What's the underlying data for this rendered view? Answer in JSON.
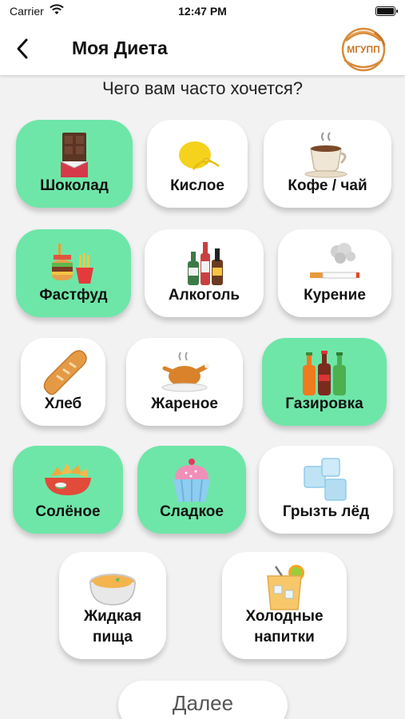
{
  "status_bar": {
    "carrier": "Carrier",
    "time": "12:47 PM"
  },
  "nav": {
    "title": "Моя Диета",
    "logo_text": "МГУПП"
  },
  "question": "Чего вам часто хочется?",
  "options": [
    {
      "label": "Шоколад",
      "selected": true,
      "icon": "chocolate-icon"
    },
    {
      "label": "Кислое",
      "selected": false,
      "icon": "lemon-icon"
    },
    {
      "label": "Кофе / чай",
      "selected": false,
      "icon": "coffee-cup-icon"
    },
    {
      "label": "Фастфуд",
      "selected": true,
      "icon": "fastfood-icon"
    },
    {
      "label": "Алкоголь",
      "selected": false,
      "icon": "bottles-icon"
    },
    {
      "label": "Курение",
      "selected": false,
      "icon": "cigarette-icon"
    },
    {
      "label": "Хлеб",
      "selected": false,
      "icon": "bread-icon"
    },
    {
      "label": "Жареное",
      "selected": false,
      "icon": "roast-chicken-icon"
    },
    {
      "label": "Газировка",
      "selected": true,
      "icon": "soda-bottles-icon"
    },
    {
      "label": "Солёное",
      "selected": true,
      "icon": "chips-bowl-icon"
    },
    {
      "label": "Сладкое",
      "selected": true,
      "icon": "cupcake-icon"
    },
    {
      "label": "Грызть лёд",
      "selected": false,
      "icon": "ice-cubes-icon"
    },
    {
      "label": "Жидкая пища",
      "line1": "Жидкая",
      "line2": "пища",
      "selected": false,
      "icon": "soup-bowl-icon"
    },
    {
      "label": "Холодные напитки",
      "line1": "Холодные",
      "line2": "напитки",
      "selected": false,
      "icon": "cold-drink-icon"
    }
  ],
  "next_label": "Далее",
  "colors": {
    "selected": "#6ee6a8",
    "card": "#ffffff",
    "background": "#f2f2f2"
  }
}
